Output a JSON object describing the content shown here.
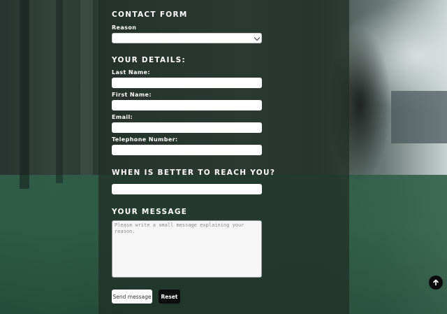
{
  "form": {
    "title": "Contact form",
    "reason_label": "Reason",
    "reason_value": "",
    "details_heading": "Your details:",
    "last_name_label": "Last Name:",
    "first_name_label": "First Name:",
    "email_label": "Email:",
    "telephone_label": "Telephone Number:",
    "reach_heading": "When is better to reach you?",
    "message_heading": "Your message",
    "message_placeholder": "Please write a small message explaining your reason.",
    "send_label": "Send message",
    "reset_label": "Reset"
  },
  "icons": {
    "select_chevron": "chevron-down-icon",
    "scroll_top": "arrow-up-icon"
  },
  "colors": {
    "panel_overlay": "#202c26",
    "heading_text": "#ffffff",
    "reset_button": "#0c0c0c",
    "send_button": "#ffffff"
  }
}
